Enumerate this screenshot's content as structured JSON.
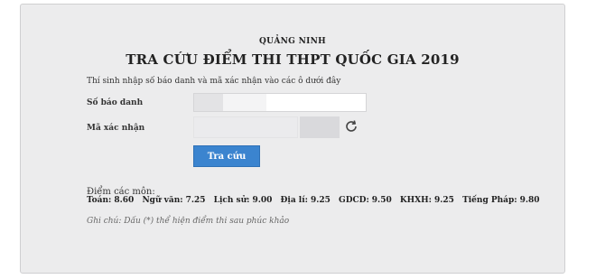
{
  "header": {
    "province": "QUẢNG NINH",
    "title": "TRA CỨU ĐIỂM THI THPT QUỐC GIA 2019"
  },
  "form": {
    "intro": "Thí sinh nhập số báo danh và mã xác nhận vào các ô dưới đây",
    "sbd_label": "Số báo danh",
    "captcha_label": "Mã xác nhận",
    "refresh_icon": "refresh-icon",
    "submit_label": "Tra cứu",
    "accent_color": "#3b84cf"
  },
  "results": {
    "heading": "Điểm các môn:",
    "scores": [
      {
        "subject": "Toán:",
        "value": "8.60"
      },
      {
        "subject": "Ngữ văn:",
        "value": "7.25"
      },
      {
        "subject": "Lịch sử:",
        "value": "9.00"
      },
      {
        "subject": "Địa lí:",
        "value": "9.25"
      },
      {
        "subject": "GDCD:",
        "value": "9.50"
      },
      {
        "subject": "KHXH:",
        "value": "9.25"
      },
      {
        "subject": "Tiếng Pháp:",
        "value": "9.80"
      }
    ],
    "note": "Ghi chú: Dấu (*) thể hiện điểm thi sau phúc khảo"
  }
}
